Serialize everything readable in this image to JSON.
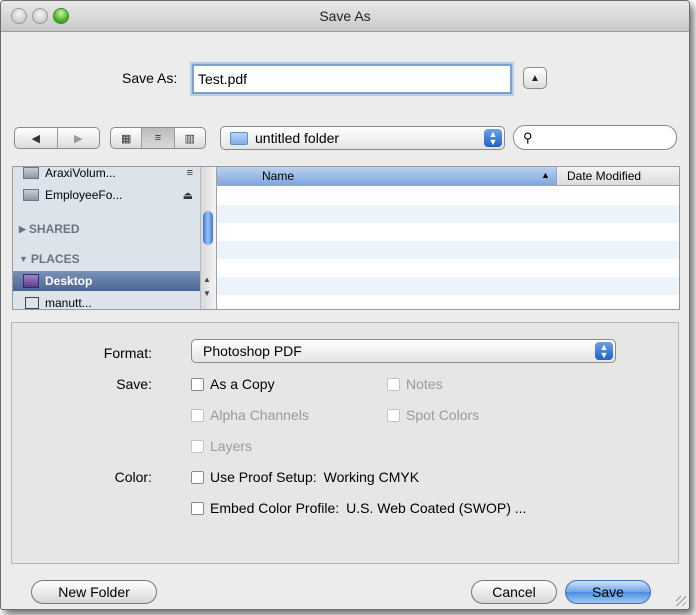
{
  "window": {
    "title": "Save As"
  },
  "save_as": {
    "label": "Save As:",
    "value": "Test.pdf",
    "expand_icon": "triangle-up"
  },
  "toolbar": {
    "back_icon": "◀",
    "forward_icon": "▶",
    "view_icon_glyph": "▦",
    "view_list_glyph": "≡",
    "view_column_glyph": "▥",
    "location": "untitled folder",
    "search_value": ""
  },
  "sidebar": {
    "devices": [
      {
        "label": "AraxiVolum...",
        "icon": "drive-icon",
        "eject": "≡"
      },
      {
        "label": "EmployeeFo...",
        "icon": "drive-icon",
        "eject": "⏏"
      }
    ],
    "shared_header": "SHARED",
    "places_header": "PLACES",
    "places": [
      {
        "label": "Desktop",
        "icon": "desktop-icon",
        "selected": true
      },
      {
        "label": "manutt...",
        "icon": "home-icon",
        "selected": false
      }
    ]
  },
  "files": {
    "columns": [
      "Name",
      "Date Modified"
    ],
    "sort_glyph": "▲",
    "rows": []
  },
  "options": {
    "format_label": "Format:",
    "format_value": "Photoshop PDF",
    "save_label": "Save:",
    "as_a_copy": "As a Copy",
    "notes": "Notes",
    "alpha_channels": "Alpha Channels",
    "spot_colors": "Spot Colors",
    "layers": "Layers",
    "color_label": "Color:",
    "use_proof_setup": "Use Proof Setup:",
    "working_cmyk": "Working CMYK",
    "embed_color_profile": "Embed Color Profile:",
    "profile_name": "U.S. Web Coated (SWOP) ..."
  },
  "buttons": {
    "new_folder": "New Folder",
    "cancel": "Cancel",
    "save": "Save"
  },
  "colors": {
    "accent": "#4b8ede",
    "selection": "#5a74a3",
    "focus_ring": "#7da2ce"
  }
}
